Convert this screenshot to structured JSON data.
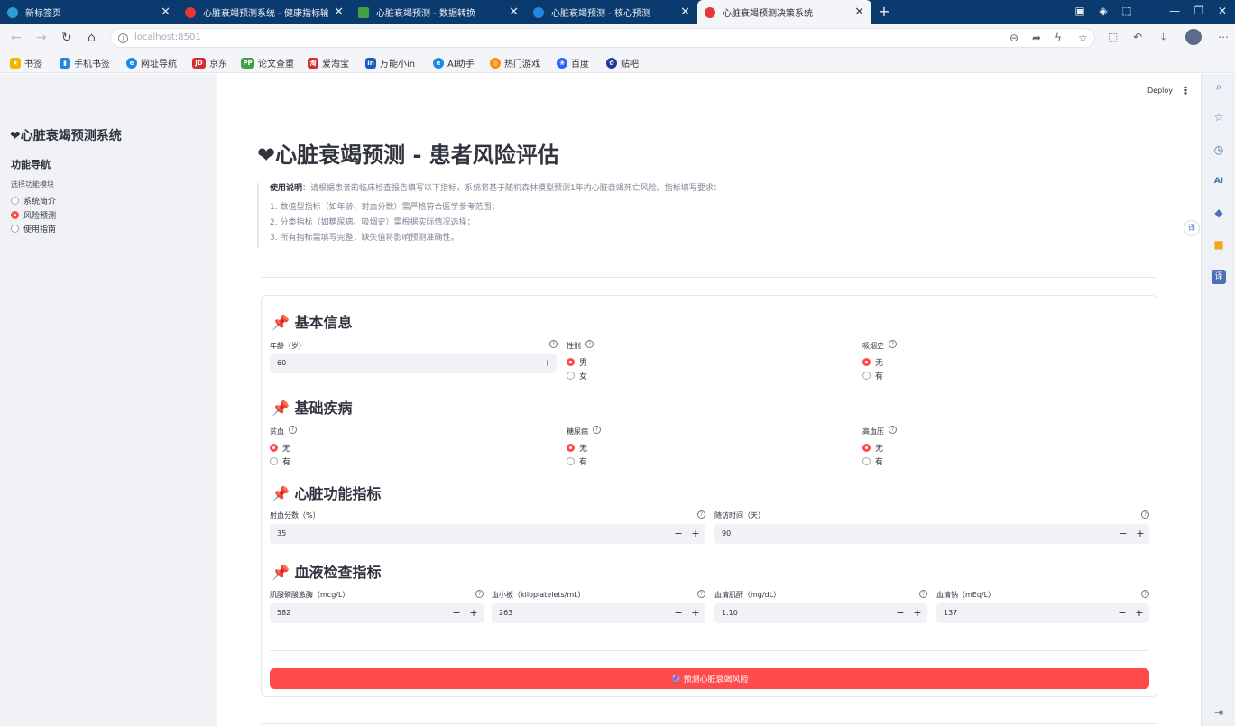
{
  "browser": {
    "tabs": [
      {
        "title": "新标签页",
        "icon_color": "#2d9cdb",
        "active": false
      },
      {
        "title": "心脏衰竭预测系统 - 健康指标输入",
        "icon_color": "#e53935",
        "active": false
      },
      {
        "title": "心脏衰竭预测 - 数据转换",
        "icon_color": "#43a047",
        "active": false
      },
      {
        "title": "心脏衰竭预测 - 核心预测",
        "icon_color": "#1e88e5",
        "active": false
      },
      {
        "title": "心脏衰竭预测决策系统",
        "icon_color": "#e53935",
        "active": true
      }
    ],
    "new_tab_icon": "+",
    "url": "localhost:8501",
    "bookmarks": [
      {
        "label": "书签",
        "icon_color": "#f4b400",
        "glyph": "★"
      },
      {
        "label": "手机书签",
        "icon_color": "#1e88e5",
        "glyph": "▮"
      },
      {
        "label": "网址导航",
        "icon_color": "#1e88e5",
        "glyph": "e"
      },
      {
        "label": "京东",
        "icon_color": "#d32f2f",
        "glyph": "JD"
      },
      {
        "label": "论文查重",
        "icon_color": "#43a047",
        "glyph": "PP"
      },
      {
        "label": "爱淘宝",
        "icon_color": "#d32f2f",
        "glyph": "淘"
      },
      {
        "label": "万能小in",
        "icon_color": "#1e5bbf",
        "glyph": "in"
      },
      {
        "label": "AI助手",
        "icon_color": "#1e88e5",
        "glyph": "e"
      },
      {
        "label": "热门游戏",
        "icon_color": "#fb8c00",
        "glyph": "◎"
      },
      {
        "label": "百度",
        "icon_color": "#2962ff",
        "glyph": "❀"
      },
      {
        "label": "贴吧",
        "icon_color": "#1e3a9e",
        "glyph": "✿"
      }
    ]
  },
  "sidebar": {
    "title": "❤心脏衰竭预测系统",
    "nav_heading": "功能导航",
    "select_label": "选择功能模块",
    "options": [
      {
        "label": "系统简介",
        "selected": false
      },
      {
        "label": "风险预测",
        "selected": true
      },
      {
        "label": "使用指南",
        "selected": false
      }
    ]
  },
  "toolbar": {
    "deploy_label": "Deploy",
    "menu_icon": "⋮"
  },
  "main": {
    "title": "❤心脏衰竭预测 - 患者风险评估",
    "intro_bold": "使用说明",
    "intro_text": "：请根据患者的临床检查报告填写以下指标，系统将基于随机森林模型预测1年内心脏衰竭死亡风险。指标填写要求：",
    "intro_items": [
      "1. 数值型指标（如年龄、射血分数）需严格符合医学参考范围；",
      "2. 分类指标（如糖尿病、吸烟史）需根据实际情况选择；",
      "3. 所有指标需填写完整，缺失值将影响预测准确性。"
    ],
    "sections": {
      "basic": "📌 基本信息",
      "disease": "📌 基础疾病",
      "heart": "📌 心脏功能指标",
      "blood": "📌 血液检查指标"
    },
    "fields": {
      "age": {
        "label": "年龄（岁）",
        "value": "60"
      },
      "sex": {
        "label": "性别",
        "options": [
          "男",
          "女"
        ],
        "selected": 0
      },
      "smoking": {
        "label": "吸烟史",
        "options": [
          "无",
          "有"
        ],
        "selected": 0
      },
      "anaemia": {
        "label": "贫血",
        "options": [
          "无",
          "有"
        ],
        "selected": 0
      },
      "diabetes": {
        "label": "糖尿病",
        "options": [
          "无",
          "有"
        ],
        "selected": 0
      },
      "hypertension": {
        "label": "高血压",
        "options": [
          "无",
          "有"
        ],
        "selected": 0
      },
      "ejection": {
        "label": "射血分数（%）",
        "value": "35"
      },
      "followup": {
        "label": "随访时间（天）",
        "value": "90"
      },
      "cpk": {
        "label": "肌酸磷酸激酶（mcg/L）",
        "value": "582"
      },
      "platelets": {
        "label": "血小板（kiloplatelets/mL）",
        "value": "263"
      },
      "creatinine": {
        "label": "血清肌酐（mg/dL）",
        "value": "1.10"
      },
      "sodium": {
        "label": "血清钠（mEq/L）",
        "value": "137"
      }
    },
    "minus": "−",
    "plus": "+",
    "help_glyph": "?",
    "predict_button": "🔮 预测心脏衰竭风险"
  },
  "colors": {
    "accent": "#ff4b4b",
    "tabbar": "#0b3a6e",
    "sidebar": "#f0f2f6"
  }
}
